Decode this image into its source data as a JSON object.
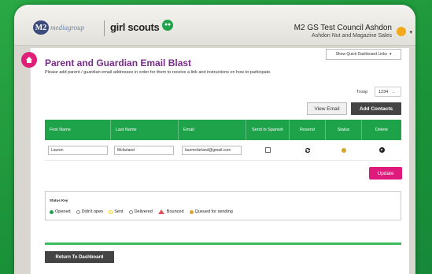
{
  "header": {
    "logo_m2": "M2",
    "logo_mediagroup": "mediagroup",
    "logo_girlscouts": "girl scouts",
    "council_name": "M2 GS Test Council Ashdon",
    "council_sub": "Ashdon Nut and Magazine Sales"
  },
  "quick_links_label": "Show Quick Dashboard Links",
  "page": {
    "title": "Parent and Guardian Email Blast",
    "subtitle": "Please add parent / guardian email addresses in order for them to receive a link and instructions on how to participate."
  },
  "troop": {
    "label": "Troop",
    "value": "1234"
  },
  "buttons": {
    "view_email": "View Email",
    "add_contacts": "Add Contacts",
    "update": "Update",
    "return_dashboard": "Return To Dashboard"
  },
  "table": {
    "headers": [
      "First Name",
      "Last Name",
      "Email",
      "Send in Spanish",
      "Resend",
      "Status",
      "Delete"
    ],
    "rows": [
      {
        "first": "Lauren",
        "last": "Mcfarland",
        "email": "laurmcfarland@gmail.com",
        "spanish": false,
        "status_color": "#d7a42a"
      }
    ]
  },
  "status_key": {
    "title": "Status Key",
    "items": [
      {
        "label": "Opened",
        "color": "#1ea34a"
      },
      {
        "label": "Didn't open",
        "color": "#ffffff"
      },
      {
        "label": "Sent",
        "color": "#f2d21b"
      },
      {
        "label": "Delivered",
        "color": "#888888"
      },
      {
        "label": "Bounced",
        "color": "#e34f5a"
      },
      {
        "label": "Queued for sending",
        "color": "#d7a42a"
      }
    ]
  },
  "colors": {
    "brand_green": "#1ea34a",
    "accent_pink": "#e0197c",
    "title_purple": "#7a2a8c"
  }
}
